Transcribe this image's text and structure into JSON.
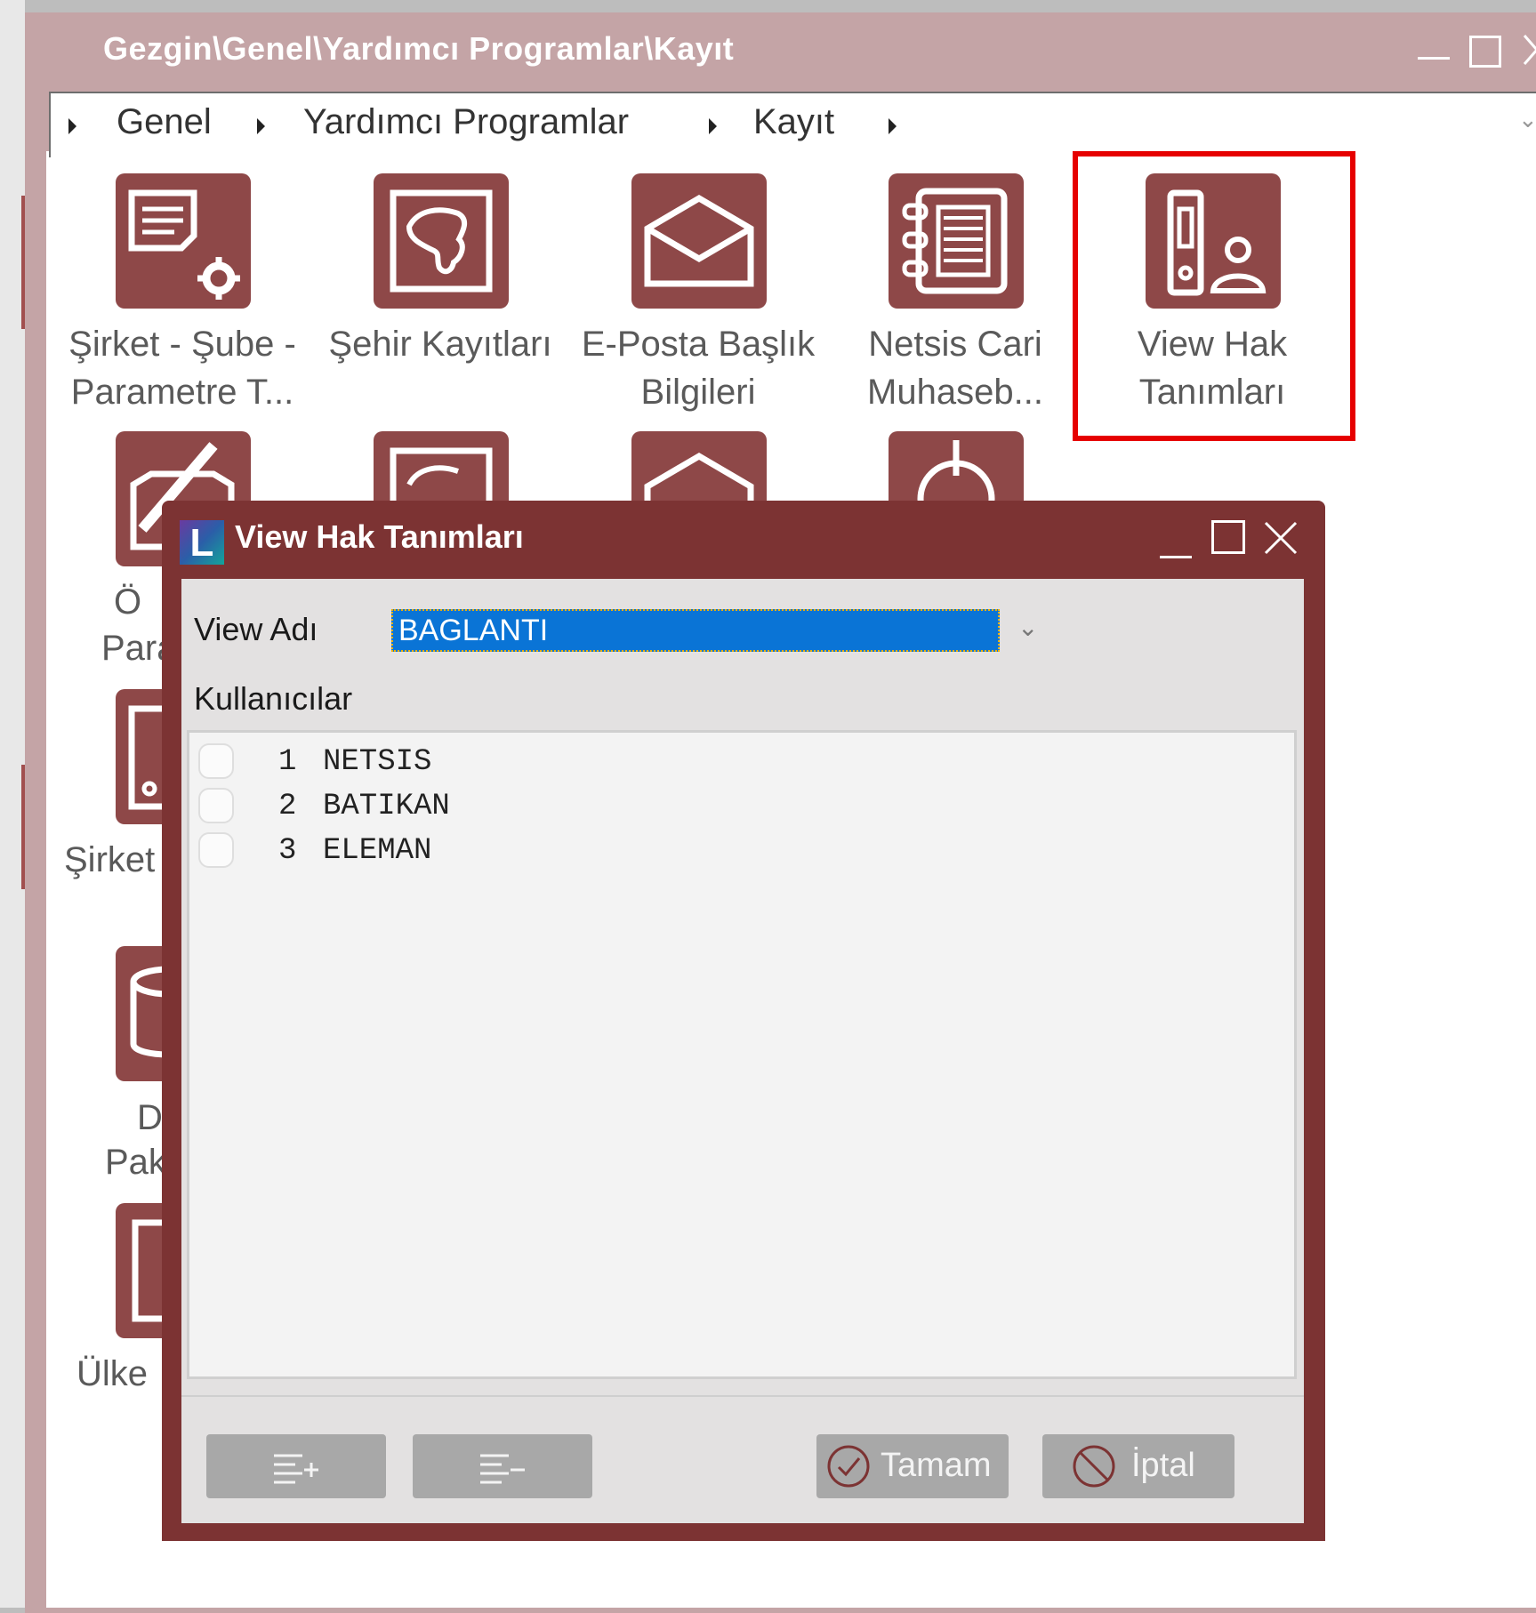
{
  "main_window": {
    "title": "Gezgin\\Genel\\Yardımcı Programlar\\Kayıt",
    "minimize": "_",
    "maximize": "☐",
    "close": "✕"
  },
  "breadcrumb": {
    "items": [
      "Genel",
      "Yardımcı Programlar",
      "Kayıt"
    ]
  },
  "tiles": [
    {
      "line1": "Şirket - Şube -",
      "line2": "Parametre T...",
      "icon": "settings-document-icon"
    },
    {
      "line1": "Şehir Kayıtları",
      "line2": "",
      "icon": "map-icon"
    },
    {
      "line1": "E-Posta Başlık",
      "line2": "Bilgileri",
      "icon": "envelope-icon"
    },
    {
      "line1": "Netsis Cari",
      "line2": "Muhaseb...",
      "icon": "ledger-icon"
    },
    {
      "line1": "View Hak",
      "line2": "Tanımları",
      "icon": "user-rights-icon"
    }
  ],
  "partial_labels": {
    "row2": "Ö",
    "row2b": "Para",
    "row3": "Şirket",
    "row4a": "D",
    "row4b": "Pak",
    "row5": "Ülke"
  },
  "dialog": {
    "title": "View Hak Tanımları",
    "logo_letter": "L",
    "minimize": "_",
    "maximize": "☐",
    "close": "✕",
    "view_label": "View Adı",
    "view_value": "BAGLANTI",
    "users_label": "Kullanıcılar",
    "users": [
      {
        "num": "1",
        "name": "NETSIS",
        "checked": false
      },
      {
        "num": "2",
        "name": "BATIKAN",
        "checked": false
      },
      {
        "num": "3",
        "name": "ELEMAN",
        "checked": false
      }
    ],
    "ok_label": "Tamam",
    "cancel_label": "İptal"
  },
  "colors": {
    "window_frame": "#c4a4a6",
    "tile": "#8e4848",
    "dialog_frame": "#7c3333",
    "highlight": "#e60000",
    "selection": "#0a74d6"
  }
}
